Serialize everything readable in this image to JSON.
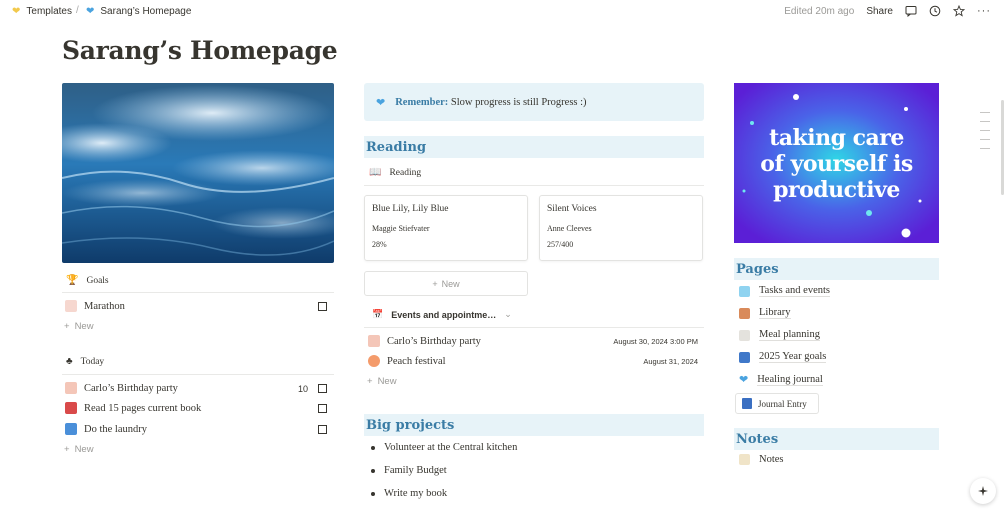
{
  "breadcrumb": {
    "parent": "Templates",
    "current": "Sarang’s Homepage"
  },
  "topbar": {
    "edited": "Edited 20m ago",
    "share": "Share"
  },
  "page": {
    "title": "Sarang’s Homepage"
  },
  "goals": {
    "heading": "Goals",
    "items": [
      {
        "label": "Marathon"
      }
    ],
    "new_label": "New"
  },
  "today": {
    "heading": "Today",
    "items": [
      {
        "label": "Carlo’s Birthday party",
        "count": "10"
      },
      {
        "label": "Read 15 pages current book"
      },
      {
        "label": "Do the laundry"
      }
    ],
    "new_label": "New"
  },
  "callout": {
    "bold": "Remember:",
    "text": " Slow progress is still Progress :)"
  },
  "reading": {
    "heading": "Reading",
    "view_label": "Reading",
    "cards": [
      {
        "title": "Blue Lily, Lily Blue",
        "author": "Maggie Stiefvater",
        "progress": "28%"
      },
      {
        "title": "Silent Voices",
        "author": "Anne Cleeves",
        "progress": "257/400"
      }
    ],
    "new_label": "New"
  },
  "events": {
    "heading": "Events and appointme…",
    "items": [
      {
        "label": "Carlo’s Birthday party",
        "date": "August 30, 2024 3:00 PM"
      },
      {
        "label": "Peach festival",
        "date": "August 31, 2024"
      }
    ],
    "new_label": "New"
  },
  "big_projects": {
    "heading": "Big projects",
    "items": [
      "Volunteer at the Central kitchen",
      "Family Budget",
      "Write my book"
    ]
  },
  "poster": {
    "line1": "taking care",
    "line2": "of yourself is",
    "line3": "productive"
  },
  "pages": {
    "heading": "Pages",
    "items": [
      {
        "label": "Tasks and events"
      },
      {
        "label": "Library"
      },
      {
        "label": "Meal planning"
      },
      {
        "label": "2025 Year goals"
      },
      {
        "label": "Healing journal"
      }
    ],
    "journal_button": "Journal Entry"
  },
  "notes": {
    "heading": "Notes",
    "items": [
      {
        "label": "Notes"
      }
    ]
  },
  "colors": {
    "accent": "#3a7ca5",
    "callout_bg": "#e7f3f8",
    "text": "#37352f",
    "muted": "#9b9a97"
  }
}
